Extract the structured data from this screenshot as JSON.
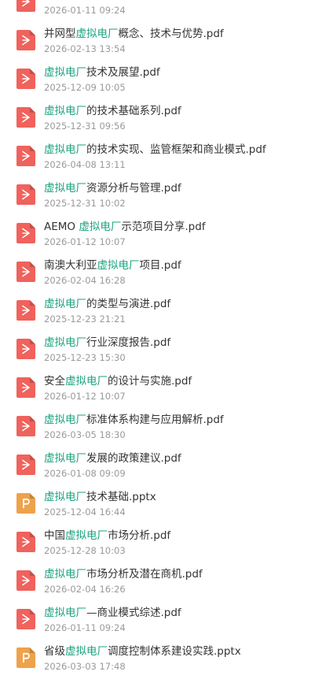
{
  "files": [
    {
      "type": "pdf",
      "icon": "pdf-file-icon",
      "prefix": "",
      "highlight": "",
      "suffix": "",
      "date": "2026-01-11 09:24"
    },
    {
      "type": "pdf",
      "icon": "pdf-file-icon",
      "prefix": "并网型",
      "highlight": "虚拟电厂",
      "suffix": "概念、技术与优势.pdf",
      "date": "2026-02-13 13:54"
    },
    {
      "type": "pdf",
      "icon": "pdf-file-icon",
      "prefix": "",
      "highlight": "虚拟电厂",
      "suffix": "技术及展望.pdf",
      "date": "2025-12-09 10:05"
    },
    {
      "type": "pdf",
      "icon": "pdf-file-icon",
      "prefix": "",
      "highlight": "虚拟电厂",
      "suffix": "的技术基础系列.pdf",
      "date": "2025-12-31 09:56"
    },
    {
      "type": "pdf",
      "icon": "pdf-file-icon",
      "prefix": "",
      "highlight": "虚拟电厂",
      "suffix": "的技术实现、监管框架和商业模式.pdf",
      "date": "2026-04-08 13:11"
    },
    {
      "type": "pdf",
      "icon": "pdf-file-icon",
      "prefix": "",
      "highlight": "虚拟电厂",
      "suffix": "资源分析与管理.pdf",
      "date": "2025-12-31 10:02"
    },
    {
      "type": "pdf",
      "icon": "pdf-file-icon",
      "prefix": "AEMO ",
      "highlight": "虚拟电厂",
      "suffix": "示范项目分享.pdf",
      "date": "2026-01-12 10:07"
    },
    {
      "type": "pdf",
      "icon": "pdf-file-icon",
      "prefix": "南澳大利亚",
      "highlight": "虚拟电厂",
      "suffix": "项目.pdf",
      "date": "2026-02-04 16:28"
    },
    {
      "type": "pdf",
      "icon": "pdf-file-icon",
      "prefix": "",
      "highlight": "虚拟电厂",
      "suffix": "的类型与演进.pdf",
      "date": "2025-12-23 21:21"
    },
    {
      "type": "pdf",
      "icon": "pdf-file-icon",
      "prefix": "",
      "highlight": "虚拟电厂",
      "suffix": "行业深度报告.pdf",
      "date": "2025-12-23 15:30"
    },
    {
      "type": "pdf",
      "icon": "pdf-file-icon",
      "prefix": "安全",
      "highlight": "虚拟电厂",
      "suffix": "的设计与实施.pdf",
      "date": "2026-01-12 10:07"
    },
    {
      "type": "pdf",
      "icon": "pdf-file-icon",
      "prefix": "",
      "highlight": "虚拟电厂",
      "suffix": "标准体系构建与应用解析.pdf",
      "date": "2026-03-05 18:30"
    },
    {
      "type": "pdf",
      "icon": "pdf-file-icon",
      "prefix": "",
      "highlight": "虚拟电厂",
      "suffix": "发展的政策建议.pdf",
      "date": "2026-01-08 09:09"
    },
    {
      "type": "pptx",
      "icon": "pptx-file-icon",
      "prefix": "",
      "highlight": "虚拟电厂",
      "suffix": "技术基础.pptx",
      "date": "2025-12-04 16:44"
    },
    {
      "type": "pdf",
      "icon": "pdf-file-icon",
      "prefix": "中国",
      "highlight": "虚拟电厂",
      "suffix": "市场分析.pdf",
      "date": "2025-12-28 10:03"
    },
    {
      "type": "pdf",
      "icon": "pdf-file-icon",
      "prefix": "",
      "highlight": "虚拟电厂",
      "suffix": "市场分析及潜在商机.pdf",
      "date": "2026-02-04 16:26"
    },
    {
      "type": "pdf",
      "icon": "pdf-file-icon",
      "prefix": "",
      "highlight": "虚拟电厂",
      "suffix": "—商业模式综述.pdf",
      "date": "2026-01-11 09:24"
    },
    {
      "type": "pptx",
      "icon": "pptx-file-icon",
      "prefix": "省级",
      "highlight": "虚拟电厂",
      "suffix": "调度控制体系建设实践.pptx",
      "date": "2026-03-03 17:48"
    }
  ],
  "colors": {
    "pdf": "#f0625c",
    "pptx": "#eea24a",
    "highlight": "#1aa27e",
    "text": "#333333",
    "date": "#9a9a9a"
  }
}
